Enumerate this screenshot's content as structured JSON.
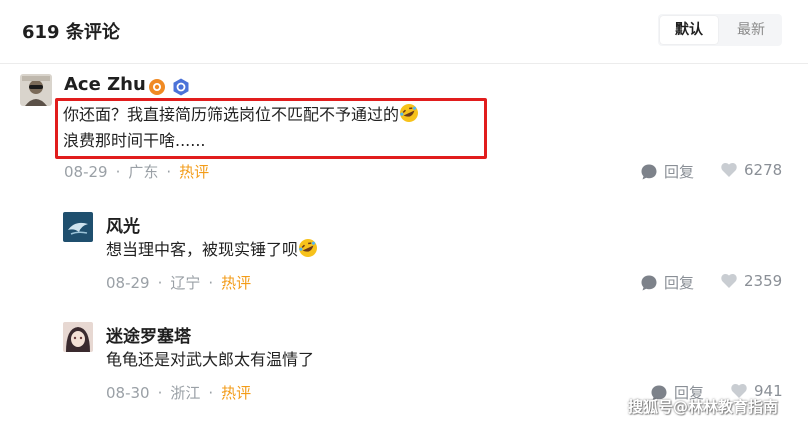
{
  "header": {
    "title": "619 条评论",
    "sort_options": [
      "默认",
      "最新"
    ],
    "sort_selected": "默认"
  },
  "comments": [
    {
      "user": "Ace Zhu",
      "badges": [
        "orange-medal-icon",
        "blue-verified-icon"
      ],
      "lines": [
        "你还面？我直接简历筛选岗位不匹配不予通过的",
        "浪费那时间干啥......"
      ],
      "line1_emoji": "rofl-emoji-icon",
      "date": "08-29",
      "location": "广东",
      "tag": "热评",
      "reply_label": "回复",
      "likes": "6278"
    },
    {
      "user": "风光",
      "text": "想当理中客，被现实锤了呗",
      "text_emoji": "rofl-emoji-icon",
      "date": "08-29",
      "location": "辽宁",
      "tag": "热评",
      "reply_label": "回复",
      "likes": "2359"
    },
    {
      "user": "迷途罗塞塔",
      "text": "龟龟还是对武大郎太有温情了",
      "date": "08-30",
      "location": "浙江",
      "tag": "热评",
      "reply_label": "回复",
      "likes": "941"
    }
  ],
  "watermark": "搜狐号@林林教育指南",
  "colors": {
    "hot_tag": "#f39c19",
    "highlight_box": "#e11d1d",
    "meta_text": "#9aa0a6"
  }
}
